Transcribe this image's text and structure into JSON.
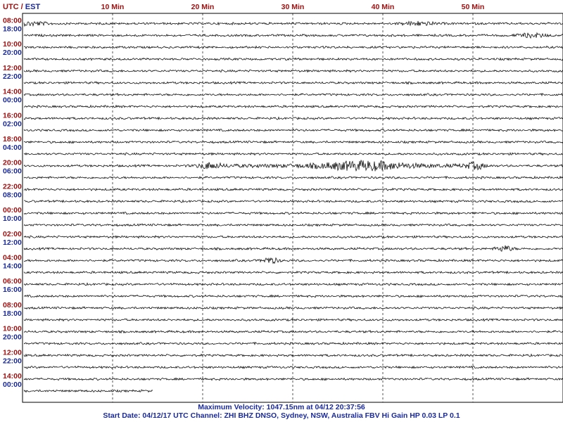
{
  "header": {
    "utc": "UTC",
    "separator": " / ",
    "est": "EST"
  },
  "footer": {
    "line1": "Maximum Velocity: 1047.15nm at 04/12 20:37:56",
    "line2": "Start Date: 04/12/17 UTC Channel: ZHI  BHZ  DNSO, Sydney, NSW, Australia  FBV Hi Gain HP 0.03  LP 0.1"
  },
  "colors": {
    "utc": "#a01010",
    "est": "#1a2a9a",
    "trace": "#111111",
    "grid": "#555555"
  },
  "chart_data": {
    "type": "line",
    "title": "",
    "xlabel": "",
    "ylabel": "",
    "xlim": [
      0,
      60
    ],
    "x_ticks": [
      {
        "value": 10,
        "label": "10 Min"
      },
      {
        "value": 20,
        "label": "20 Min"
      },
      {
        "value": 30,
        "label": "30 Min"
      },
      {
        "value": 40,
        "label": "40 Min"
      },
      {
        "value": 50,
        "label": "50 Min"
      }
    ],
    "row_count": 32,
    "minutes_per_row": 60,
    "last_row_end_minutes": 14.5,
    "time_labels": [
      {
        "row": 0,
        "utc": "08:00",
        "est": "18:00"
      },
      {
        "row": 2,
        "utc": "10:00",
        "est": "20:00"
      },
      {
        "row": 4,
        "utc": "12:00",
        "est": "22:00"
      },
      {
        "row": 6,
        "utc": "14:00",
        "est": "00:00"
      },
      {
        "row": 8,
        "utc": "16:00",
        "est": "02:00"
      },
      {
        "row": 10,
        "utc": "18:00",
        "est": "04:00"
      },
      {
        "row": 12,
        "utc": "20:00",
        "est": "06:00"
      },
      {
        "row": 14,
        "utc": "22:00",
        "est": "08:00"
      },
      {
        "row": 16,
        "utc": "00:00",
        "est": "10:00"
      },
      {
        "row": 18,
        "utc": "02:00",
        "est": "12:00"
      },
      {
        "row": 20,
        "utc": "04:00",
        "est": "14:00"
      },
      {
        "row": 22,
        "utc": "06:00",
        "est": "16:00"
      },
      {
        "row": 24,
        "utc": "08:00",
        "est": "18:00"
      },
      {
        "row": 26,
        "utc": "10:00",
        "est": "20:00"
      },
      {
        "row": 28,
        "utc": "12:00",
        "est": "22:00"
      },
      {
        "row": 30,
        "utc": "14:00",
        "est": "00:00"
      }
    ],
    "events": [
      {
        "row": 0,
        "minute": 1.0,
        "label": "noise burst"
      },
      {
        "row": 0,
        "minute": 44.0,
        "label": "noise burst"
      },
      {
        "row": 1,
        "minute": 56.5,
        "label": "noise burst"
      },
      {
        "row": 12,
        "minute": 20.5,
        "label": "onset"
      },
      {
        "row": 12,
        "minute": 37.8,
        "label": "maximum"
      },
      {
        "row": 12,
        "minute": 50.3,
        "label": "coda"
      },
      {
        "row": 19,
        "minute": 53.5,
        "label": "spike"
      },
      {
        "row": 20,
        "minute": 27.5,
        "label": "spike"
      }
    ]
  }
}
